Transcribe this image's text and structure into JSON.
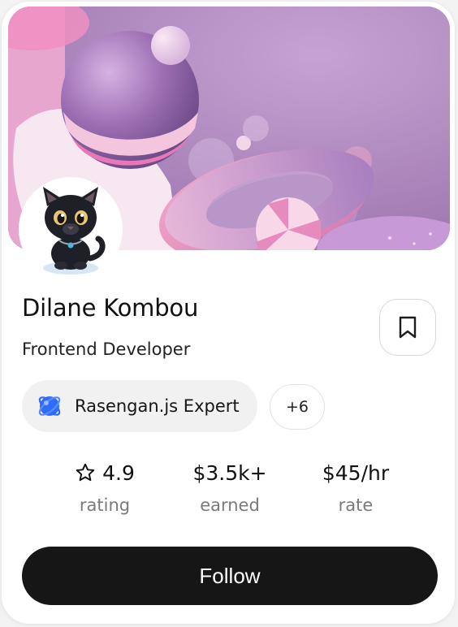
{
  "profile": {
    "name": "Dilane Kombou",
    "role": "Frontend Developer"
  },
  "skills": {
    "primary_label": "Rasengan.js Expert",
    "primary_icon": "rasengan-logo-icon",
    "more_label": "+6"
  },
  "stats": [
    {
      "value": "4.9",
      "label": "rating",
      "icon": "star-outline-icon"
    },
    {
      "value": "$3.5k+",
      "label": "earned"
    },
    {
      "value": "$45/hr",
      "label": "rate"
    }
  ],
  "actions": {
    "follow_label": "Follow",
    "bookmark_icon": "bookmark-icon"
  },
  "colors": {
    "accent": "#161616",
    "banner_pink": "#e6b9dd",
    "banner_purple": "#a77fb7",
    "muted_text": "#7a7a7a",
    "chip_bg": "#f1f1f1",
    "skill_icon_blue": "#2f6bff"
  }
}
